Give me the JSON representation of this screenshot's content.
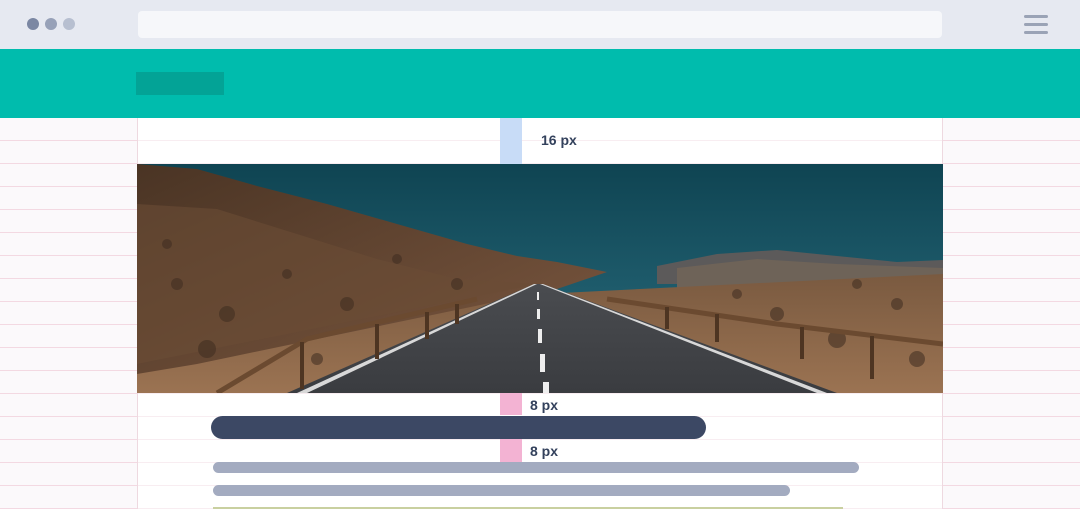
{
  "browser": {
    "window_controls": [
      "close-dot",
      "minimize-dot",
      "maximize-dot"
    ],
    "menu_icon": "hamburger-menu-icon"
  },
  "header": {
    "background_color": "#00bcad",
    "logo_placeholder_color": "#03a396"
  },
  "spacing_annotations": {
    "top_gap_label": "16 px",
    "gap_after_image_label": "8 px",
    "gap_after_title_label": "8 px",
    "top_gap_color": "#c8dcf7",
    "small_gap_color": "#f3b3d3"
  },
  "hero": {
    "image_icon": "desert-road-photo"
  },
  "placeholders": {
    "title_bar_color": "#3c4864",
    "text_bar_color": "#a3abc0"
  }
}
